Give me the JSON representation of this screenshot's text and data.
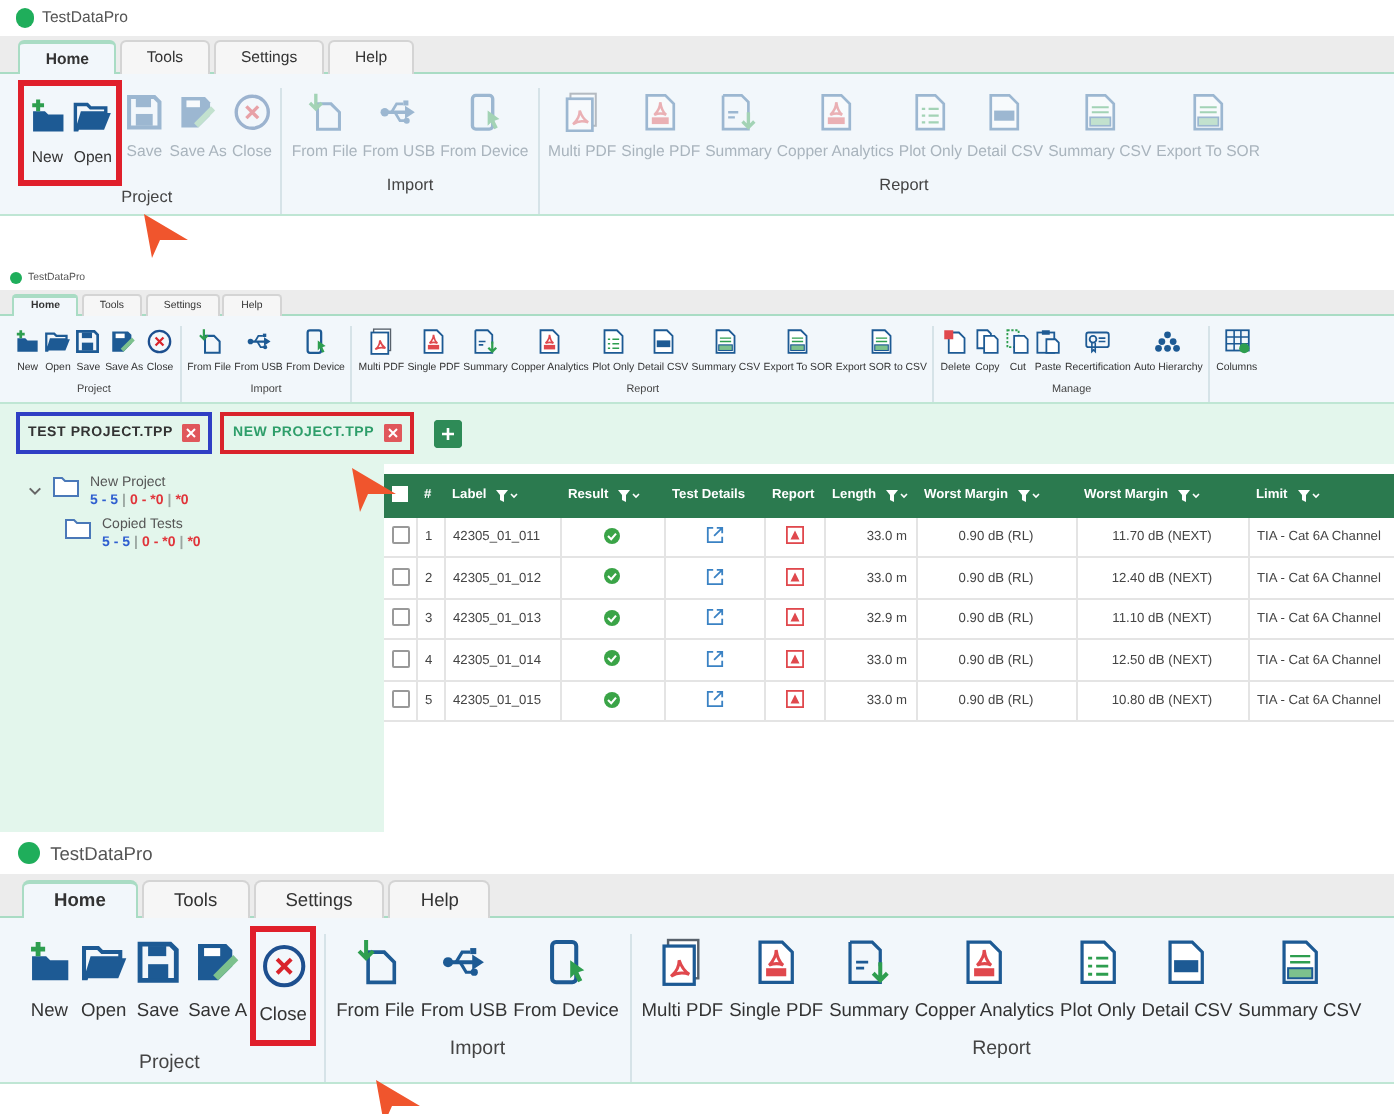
{
  "screens": [
    {
      "app_title": "TestDataPro",
      "callout_arrow": true,
      "tabs": [
        {
          "label": "Home",
          "selected": true
        },
        {
          "label": "Tools",
          "selected": false
        },
        {
          "label": "Settings",
          "selected": false
        },
        {
          "label": "Help",
          "selected": false
        }
      ],
      "ribbon_groups": [
        {
          "label": "Project",
          "buttons": [
            {
              "label": "New",
              "kind": "new",
              "disabled": false,
              "highlighted": true
            },
            {
              "label": "Open",
              "kind": "open",
              "disabled": false,
              "highlighted": true
            },
            {
              "label": "Save",
              "kind": "save",
              "disabled": true,
              "highlighted": false
            },
            {
              "label": "Save As",
              "kind": "save-as",
              "disabled": true,
              "highlighted": false
            },
            {
              "label": "Close",
              "kind": "close",
              "disabled": true,
              "highlighted": false
            }
          ]
        },
        {
          "label": "Import",
          "buttons": [
            {
              "label": "From File",
              "kind": "from-file",
              "disabled": true,
              "highlighted": false
            },
            {
              "label": "From USB",
              "kind": "from-usb",
              "disabled": true,
              "highlighted": false
            },
            {
              "label": "From Device",
              "kind": "from-device",
              "disabled": true,
              "highlighted": false
            }
          ]
        },
        {
          "label": "Report",
          "buttons": [
            {
              "label": "Multi PDF",
              "kind": "multi-pdf",
              "disabled": true,
              "highlighted": false
            },
            {
              "label": "Single PDF",
              "kind": "pdf",
              "disabled": true,
              "highlighted": false
            },
            {
              "label": "Summary",
              "kind": "summary",
              "disabled": true,
              "highlighted": false
            },
            {
              "label": "Copper Analytics",
              "kind": "pdf",
              "disabled": true,
              "highlighted": false
            },
            {
              "label": "Plot Only",
              "kind": "plot",
              "disabled": true,
              "highlighted": false
            },
            {
              "label": "Detail CSV",
              "kind": "csv",
              "disabled": true,
              "highlighted": false
            },
            {
              "label": "Summary CSV",
              "kind": "csv-lines",
              "disabled": true,
              "highlighted": false
            },
            {
              "label": "Export To SOR",
              "kind": "csv-lines",
              "disabled": true,
              "highlighted": false
            }
          ]
        }
      ]
    },
    {
      "app_title": "TestDataPro",
      "callout_arrow": true,
      "tabs": [
        {
          "label": "Home",
          "selected": true
        },
        {
          "label": "Tools",
          "selected": false
        },
        {
          "label": "Settings",
          "selected": false
        },
        {
          "label": "Help",
          "selected": false
        }
      ],
      "ribbon_groups": [
        {
          "label": "Project",
          "buttons": [
            {
              "label": "New",
              "kind": "new",
              "disabled": false,
              "highlighted": false
            },
            {
              "label": "Open",
              "kind": "open",
              "disabled": false,
              "highlighted": false
            },
            {
              "label": "Save",
              "kind": "save",
              "disabled": false,
              "highlighted": false
            },
            {
              "label": "Save As",
              "kind": "save-as",
              "disabled": false,
              "highlighted": false
            },
            {
              "label": "Close",
              "kind": "close",
              "disabled": false,
              "highlighted": false
            }
          ]
        },
        {
          "label": "Import",
          "buttons": [
            {
              "label": "From File",
              "kind": "from-file",
              "disabled": false,
              "highlighted": false
            },
            {
              "label": "From USB",
              "kind": "from-usb",
              "disabled": false,
              "highlighted": false
            },
            {
              "label": "From Device",
              "kind": "from-device",
              "disabled": false,
              "highlighted": false
            }
          ]
        },
        {
          "label": "Report",
          "buttons": [
            {
              "label": "Multi PDF",
              "kind": "multi-pdf",
              "disabled": false,
              "highlighted": false
            },
            {
              "label": "Single PDF",
              "kind": "pdf",
              "disabled": false,
              "highlighted": false
            },
            {
              "label": "Summary",
              "kind": "summary",
              "disabled": false,
              "highlighted": false
            },
            {
              "label": "Copper Analytics",
              "kind": "pdf",
              "disabled": false,
              "highlighted": false
            },
            {
              "label": "Plot Only",
              "kind": "plot",
              "disabled": false,
              "highlighted": false
            },
            {
              "label": "Detail CSV",
              "kind": "csv",
              "disabled": false,
              "highlighted": false
            },
            {
              "label": "Summary CSV",
              "kind": "csv-lines",
              "disabled": false,
              "highlighted": false
            },
            {
              "label": "Export To SOR",
              "kind": "csv-lines",
              "disabled": false,
              "highlighted": false
            },
            {
              "label": "Export SOR to CSV",
              "kind": "csv-lines",
              "disabled": false,
              "highlighted": false
            }
          ]
        },
        {
          "label": "Manage",
          "buttons": [
            {
              "label": "Delete",
              "kind": "delete",
              "disabled": false,
              "highlighted": false
            },
            {
              "label": "Copy",
              "kind": "copy",
              "disabled": false,
              "highlighted": false
            },
            {
              "label": "Cut",
              "kind": "cut",
              "disabled": false,
              "highlighted": false
            },
            {
              "label": "Paste",
              "kind": "paste",
              "disabled": false,
              "highlighted": false
            },
            {
              "label": "Recertification",
              "kind": "recert",
              "disabled": false,
              "highlighted": false
            },
            {
              "label": "Auto Hierarchy",
              "kind": "hierarchy",
              "disabled": false,
              "highlighted": false
            }
          ]
        },
        {
          "buttons": [
            {
              "label": "Columns",
              "kind": "columns",
              "disabled": false,
              "highlighted": false
            }
          ]
        }
      ],
      "project_tabs": [
        {
          "label": "TEST PROJECT.TPP",
          "selected": false,
          "color": "#2f3fc4"
        },
        {
          "label": "NEW PROJECT.TPP",
          "selected": true,
          "color": "#d9232b"
        }
      ],
      "tree": [
        {
          "label": "New Project",
          "expanded": true,
          "counts": [
            {
              "text": "5 - 5",
              "color": "#2f5fd0"
            },
            {
              "text": "|"
            },
            {
              "text": "0 - *0",
              "color": "#e0343a"
            },
            {
              "text": "|"
            },
            {
              "text": "*0",
              "color": "#e0343a"
            }
          ],
          "children": [
            {
              "label": "Copied Tests",
              "counts": [
                {
                  "text": "5 - 5",
                  "color": "#2f5fd0"
                },
                {
                  "text": "|"
                },
                {
                  "text": "0 - *0",
                  "color": "#e0343a"
                },
                {
                  "text": "|"
                },
                {
                  "text": "*0",
                  "color": "#e0343a"
                }
              ]
            }
          ]
        }
      ],
      "table": {
        "all_checked": false,
        "columns": [
          {
            "label": "#",
            "filter": false
          },
          {
            "label": "Label",
            "filter": true
          },
          {
            "label": "Result",
            "filter": true
          },
          {
            "label": "Test Details",
            "filter": false
          },
          {
            "label": "Report",
            "filter": false
          },
          {
            "label": "Length",
            "filter": true
          },
          {
            "label": "Worst Margin",
            "filter": true
          },
          {
            "label": "Worst Margin",
            "filter": true
          },
          {
            "label": "Limit",
            "filter": true
          }
        ],
        "rows": [
          {
            "checked": false,
            "number": "1",
            "label": "42305_01_011",
            "passed": true,
            "length": "33.0 m",
            "worst_margin_1": "0.90 dB (RL)",
            "worst_margin_2": "11.70 dB (NEXT)",
            "limit": "TIA - Cat 6A Channel"
          },
          {
            "checked": false,
            "number": "2",
            "label": "42305_01_012",
            "passed": true,
            "length": "33.0 m",
            "worst_margin_1": "0.90 dB (RL)",
            "worst_margin_2": "12.40 dB (NEXT)",
            "limit": "TIA - Cat 6A Channel"
          },
          {
            "checked": false,
            "number": "3",
            "label": "42305_01_013",
            "passed": true,
            "length": "32.9 m",
            "worst_margin_1": "0.90 dB (RL)",
            "worst_margin_2": "11.10 dB (NEXT)",
            "limit": "TIA - Cat 6A Channel"
          },
          {
            "checked": false,
            "number": "4",
            "label": "42305_01_014",
            "passed": true,
            "length": "33.0 m",
            "worst_margin_1": "0.90 dB (RL)",
            "worst_margin_2": "12.50 dB (NEXT)",
            "limit": "TIA - Cat 6A Channel"
          },
          {
            "checked": false,
            "number": "5",
            "label": "42305_01_015",
            "passed": true,
            "length": "33.0 m",
            "worst_margin_1": "0.90 dB (RL)",
            "worst_margin_2": "10.80 dB (NEXT)",
            "limit": "TIA - Cat 6A Channel"
          }
        ]
      }
    },
    {
      "app_title": "TestDataPro",
      "callout_arrow": true,
      "tabs": [
        {
          "label": "Home",
          "selected": true
        },
        {
          "label": "Tools",
          "selected": false
        },
        {
          "label": "Settings",
          "selected": false
        },
        {
          "label": "Help",
          "selected": false
        }
      ],
      "ribbon_groups": [
        {
          "label": "Project",
          "buttons": [
            {
              "label": "New",
              "kind": "new",
              "disabled": false,
              "highlighted": false
            },
            {
              "label": "Open",
              "kind": "open",
              "disabled": false,
              "highlighted": false
            },
            {
              "label": "Save",
              "kind": "save",
              "disabled": false,
              "highlighted": false
            },
            {
              "label": "Save A",
              "kind": "save-as",
              "disabled": false,
              "highlighted": false
            },
            {
              "label": "Close",
              "kind": "close",
              "disabled": false,
              "highlighted": true
            }
          ]
        },
        {
          "label": "Import",
          "buttons": [
            {
              "label": "From File",
              "kind": "from-file",
              "disabled": false,
              "highlighted": false
            },
            {
              "label": "From USB",
              "kind": "from-usb",
              "disabled": false,
              "highlighted": false
            },
            {
              "label": "From Device",
              "kind": "from-device",
              "disabled": false,
              "highlighted": false
            }
          ]
        },
        {
          "label": "Report",
          "buttons": [
            {
              "label": "Multi PDF",
              "kind": "multi-pdf",
              "disabled": false,
              "highlighted": false
            },
            {
              "label": "Single PDF",
              "kind": "pdf",
              "disabled": false,
              "highlighted": false
            },
            {
              "label": "Summary",
              "kind": "summary",
              "disabled": false,
              "highlighted": false
            },
            {
              "label": "Copper Analytics",
              "kind": "pdf",
              "disabled": false,
              "highlighted": false
            },
            {
              "label": "Plot Only",
              "kind": "plot",
              "disabled": false,
              "highlighted": false
            },
            {
              "label": "Detail CSV",
              "kind": "csv",
              "disabled": false,
              "highlighted": false
            },
            {
              "label": "Summary CSV",
              "kind": "csv-lines",
              "disabled": false,
              "highlighted": false
            }
          ]
        }
      ]
    }
  ]
}
